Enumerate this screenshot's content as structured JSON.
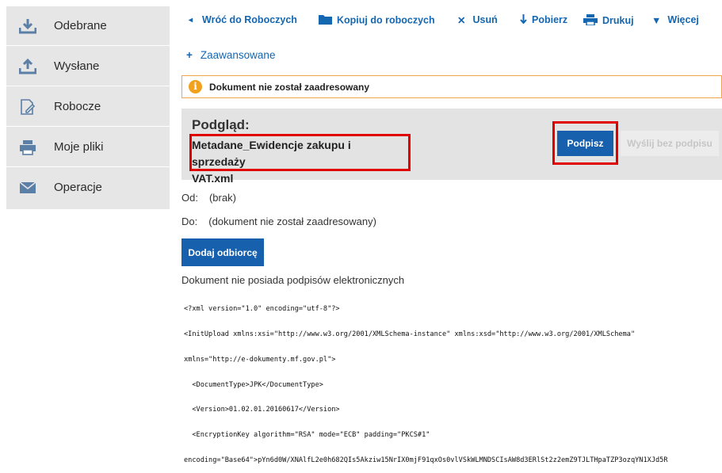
{
  "sidebar": {
    "items": [
      {
        "label": "Odebrane",
        "icon": "download-icon"
      },
      {
        "label": "Wysłane",
        "icon": "upload-icon"
      },
      {
        "label": "Robocze",
        "icon": "draft-icon"
      },
      {
        "label": "Moje pliki",
        "icon": "printer-icon"
      },
      {
        "label": "Operacje",
        "icon": "mail-icon"
      }
    ]
  },
  "toolbar": {
    "back": "Wróć do Roboczych",
    "copy": "Kopiuj do roboczych",
    "delete": "Usuń",
    "download": "Pobierz",
    "print": "Drukuj",
    "more": "Więcej"
  },
  "advanced": "Zaawansowane",
  "alert": "Dokument nie został zaadresowany",
  "preview": {
    "title": "Podgląd:",
    "file_line1": "Metadane_Ewidencje zakupu i sprzedaży",
    "file_line2": "VAT.xml",
    "sign_button": "Podpisz",
    "send_unsigned_button": "Wyślij bez podpisu"
  },
  "from": {
    "label": "Od:",
    "value": "(brak)"
  },
  "to": {
    "label": "Do:",
    "value": "(dokument nie został zaadresowany)"
  },
  "add_recipient": "Dodaj odbiorcę",
  "no_signatures": "Dokument nie posiada podpisów elektronicznych",
  "xml_lines": [
    "<?xml version=\"1.0\" encoding=\"utf-8\"?>",
    "<InitUpload xmlns:xsi=\"http://www.w3.org/2001/XMLSchema-instance\" xmlns:xsd=\"http://www.w3.org/2001/XMLSchema\"",
    "xmlns=\"http://e-dokumenty.mf.gov.pl\">",
    "  <DocumentType>JPK</DocumentType>",
    "  <Version>01.02.01.20160617</Version>",
    "  <EncryptionKey algorithm=\"RSA\" mode=\"ECB\" padding=\"PKCS#1\"",
    "encoding=\"Base64\">pYn6d0W/XNAlfL2e0h682QIs5Akziw15NrIX0mjF91qxOs0vlVSkWLMNDSCIsAW8d3ERlSt2z2emZ9TJLTHpaTZP3ozqYN1XJd5R"
  ],
  "colors": {
    "accent": "#1760ad",
    "link": "#1467b0",
    "highlight": "#e00000",
    "warning": "#f0a11e"
  }
}
